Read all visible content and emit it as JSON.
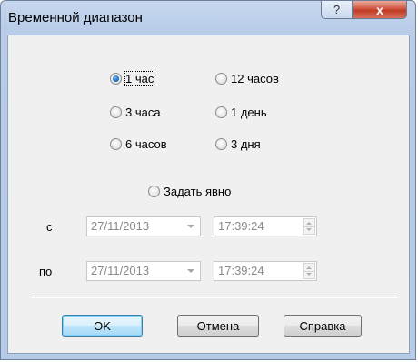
{
  "window": {
    "title": "Временной диапазон",
    "help_glyph": "?",
    "close_glyph": "x"
  },
  "radios": [
    {
      "label": "1 час",
      "checked": true
    },
    {
      "label": "12 часов",
      "checked": false
    },
    {
      "label": "3 часа",
      "checked": false
    },
    {
      "label": "1 день",
      "checked": false
    },
    {
      "label": "6 часов",
      "checked": false
    },
    {
      "label": "3 дня",
      "checked": false
    }
  ],
  "explicit": {
    "label": "Задать явно",
    "checked": false
  },
  "range": {
    "from_label": "с",
    "to_label": "по",
    "from_date": "27/11/2013",
    "from_time": "17:39:24",
    "to_date": "27/11/2013",
    "to_time": "17:39:24"
  },
  "buttons": {
    "ok": "OK",
    "cancel": "Отмена",
    "help": "Справка"
  },
  "colors": {
    "radio_selected": "#1e6fc2",
    "default_button_border": "#3c7fb1",
    "close_button": "#c03b24"
  }
}
